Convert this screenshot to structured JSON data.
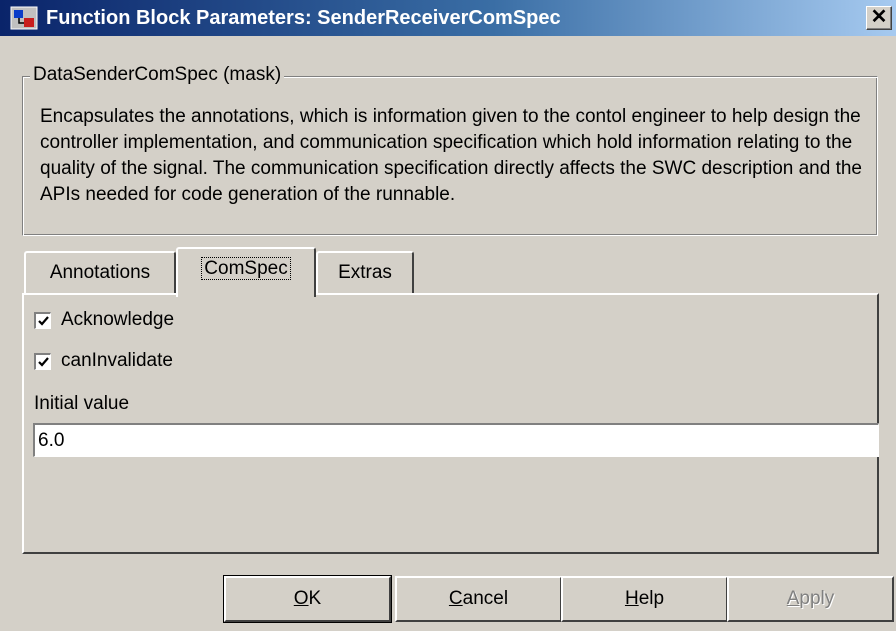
{
  "window": {
    "title": "Function Block Parameters: SenderReceiverComSpec",
    "close_glyph": "✕"
  },
  "group": {
    "legend": "DataSenderComSpec (mask)",
    "description": "Encapsulates the annotations, which is information given to the contol engineer to help design the controller implementation, and communication specification which hold information relating to the quality of the signal. The communication specification directly affects the SWC description and the APIs needed for code generation of the runnable."
  },
  "tabs": [
    {
      "label": "Annotations",
      "active": false
    },
    {
      "label": "ComSpec",
      "active": true
    },
    {
      "label": "Extras",
      "active": false
    }
  ],
  "comspec": {
    "acknowledge": {
      "label": "Acknowledge",
      "checked": true
    },
    "can_invalidate": {
      "label": "canInvalidate",
      "checked": true
    },
    "initial_value": {
      "label": "Initial value",
      "value": "6.0"
    }
  },
  "buttons": {
    "ok": {
      "mnemonic": "O",
      "rest": "K"
    },
    "cancel": {
      "mnemonic": "C",
      "rest": "ancel"
    },
    "help": {
      "mnemonic": "H",
      "rest": "elp"
    },
    "apply": {
      "mnemonic": "A",
      "rest": "pply",
      "enabled": false
    }
  },
  "colors": {
    "dialog_bg": "#d4d0c8",
    "titlebar_start": "#0a246a",
    "titlebar_end": "#a6caf0"
  }
}
